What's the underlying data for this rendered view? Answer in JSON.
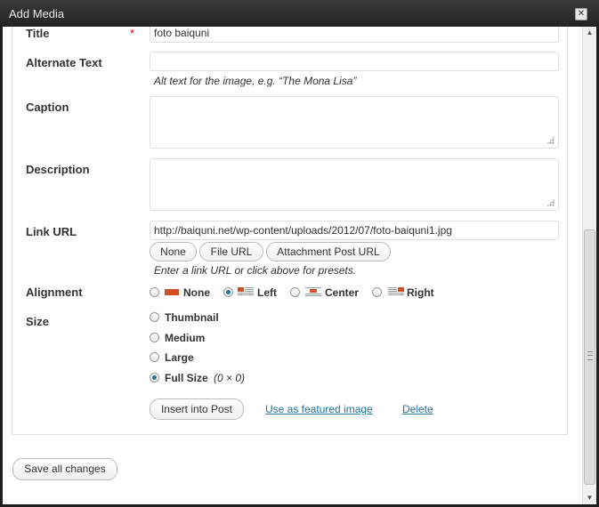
{
  "window": {
    "title": "Add Media",
    "close_glyph": "✕"
  },
  "fields": {
    "title": {
      "label": "Title",
      "required_mark": "*",
      "value": "foto baiquni"
    },
    "alt": {
      "label": "Alternate Text",
      "value": "",
      "help": "Alt text for the image, e.g. “The Mona Lisa”"
    },
    "caption": {
      "label": "Caption",
      "value": ""
    },
    "description": {
      "label": "Description",
      "value": ""
    },
    "link": {
      "label": "Link URL",
      "value": "http://baiquni.net/wp-content/uploads/2012/07/foto-baiquni1.jpg",
      "buttons": [
        "None",
        "File URL",
        "Attachment Post URL"
      ],
      "help": "Enter a link URL or click above for presets."
    }
  },
  "alignment": {
    "label": "Alignment",
    "options": [
      {
        "label": "None",
        "checked": false,
        "icon": "align-none-icon"
      },
      {
        "label": "Left",
        "checked": true,
        "icon": "align-left-icon"
      },
      {
        "label": "Center",
        "checked": false,
        "icon": "align-center-icon"
      },
      {
        "label": "Right",
        "checked": false,
        "icon": "align-right-icon"
      }
    ]
  },
  "size": {
    "label": "Size",
    "options": [
      {
        "label": "Thumbnail",
        "checked": false
      },
      {
        "label": "Medium",
        "checked": false
      },
      {
        "label": "Large",
        "checked": false
      },
      {
        "label": "Full Size",
        "checked": true,
        "dims": "(0 × 0)"
      }
    ]
  },
  "actions": {
    "insert": "Insert into Post",
    "featured": "Use as featured image",
    "delete": "Delete"
  },
  "footer": {
    "save_all": "Save all changes"
  },
  "colors": {
    "link": "#21759b",
    "required": "#dd0000",
    "icon_red": "#d54e21"
  }
}
